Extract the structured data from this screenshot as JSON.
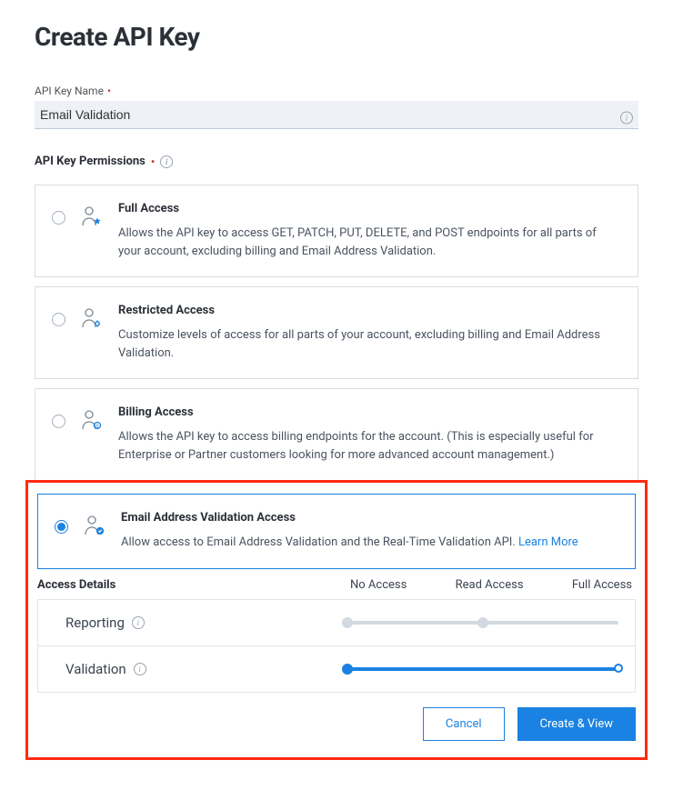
{
  "page": {
    "title": "Create API Key"
  },
  "nameField": {
    "label": "API Key Name",
    "value": "Email Validation"
  },
  "permissionsSection": {
    "label": "API Key Permissions"
  },
  "permissions": [
    {
      "id": "full",
      "title": "Full Access",
      "desc": "Allows the API key to access GET, PATCH, PUT, DELETE, and POST endpoints for all parts of your account, excluding billing and Email Address Validation.",
      "selected": false
    },
    {
      "id": "restricted",
      "title": "Restricted Access",
      "desc": "Customize levels of access for all parts of your account, excluding billing and Email Address Validation.",
      "selected": false
    },
    {
      "id": "billing",
      "title": "Billing Access",
      "desc": "Allows the API key to access billing endpoints for the account. (This is especially useful for Enterprise or Partner customers looking for more advanced account management.)",
      "selected": false
    },
    {
      "id": "eav",
      "title": "Email Address Validation Access",
      "desc": "Allow access to Email Address Validation and the Real-Time Validation API. ",
      "learnMore": "Learn More",
      "selected": true
    }
  ],
  "accessDetails": {
    "title": "Access Details",
    "columns": [
      "No Access",
      "Read Access",
      "Full Access"
    ],
    "rows": [
      {
        "label": "Reporting",
        "level": 1,
        "active": false
      },
      {
        "label": "Validation",
        "level": 2,
        "active": true
      }
    ]
  },
  "buttons": {
    "cancel": "Cancel",
    "create": "Create & View"
  }
}
